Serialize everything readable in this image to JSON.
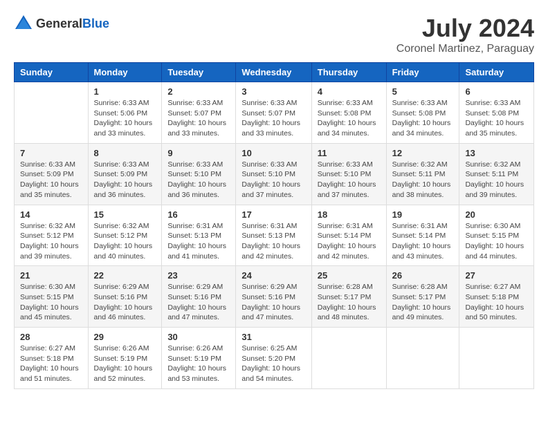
{
  "header": {
    "logo_general": "General",
    "logo_blue": "Blue",
    "month_year": "July 2024",
    "location": "Coronel Martinez, Paraguay"
  },
  "days_of_week": [
    "Sunday",
    "Monday",
    "Tuesday",
    "Wednesday",
    "Thursday",
    "Friday",
    "Saturday"
  ],
  "weeks": [
    [
      {
        "day": "",
        "sunrise": "",
        "sunset": "",
        "daylight": ""
      },
      {
        "day": "1",
        "sunrise": "Sunrise: 6:33 AM",
        "sunset": "Sunset: 5:06 PM",
        "daylight": "Daylight: 10 hours and 33 minutes."
      },
      {
        "day": "2",
        "sunrise": "Sunrise: 6:33 AM",
        "sunset": "Sunset: 5:07 PM",
        "daylight": "Daylight: 10 hours and 33 minutes."
      },
      {
        "day": "3",
        "sunrise": "Sunrise: 6:33 AM",
        "sunset": "Sunset: 5:07 PM",
        "daylight": "Daylight: 10 hours and 33 minutes."
      },
      {
        "day": "4",
        "sunrise": "Sunrise: 6:33 AM",
        "sunset": "Sunset: 5:08 PM",
        "daylight": "Daylight: 10 hours and 34 minutes."
      },
      {
        "day": "5",
        "sunrise": "Sunrise: 6:33 AM",
        "sunset": "Sunset: 5:08 PM",
        "daylight": "Daylight: 10 hours and 34 minutes."
      },
      {
        "day": "6",
        "sunrise": "Sunrise: 6:33 AM",
        "sunset": "Sunset: 5:08 PM",
        "daylight": "Daylight: 10 hours and 35 minutes."
      }
    ],
    [
      {
        "day": "7",
        "sunrise": "Sunrise: 6:33 AM",
        "sunset": "Sunset: 5:09 PM",
        "daylight": "Daylight: 10 hours and 35 minutes."
      },
      {
        "day": "8",
        "sunrise": "Sunrise: 6:33 AM",
        "sunset": "Sunset: 5:09 PM",
        "daylight": "Daylight: 10 hours and 36 minutes."
      },
      {
        "day": "9",
        "sunrise": "Sunrise: 6:33 AM",
        "sunset": "Sunset: 5:10 PM",
        "daylight": "Daylight: 10 hours and 36 minutes."
      },
      {
        "day": "10",
        "sunrise": "Sunrise: 6:33 AM",
        "sunset": "Sunset: 5:10 PM",
        "daylight": "Daylight: 10 hours and 37 minutes."
      },
      {
        "day": "11",
        "sunrise": "Sunrise: 6:33 AM",
        "sunset": "Sunset: 5:10 PM",
        "daylight": "Daylight: 10 hours and 37 minutes."
      },
      {
        "day": "12",
        "sunrise": "Sunrise: 6:32 AM",
        "sunset": "Sunset: 5:11 PM",
        "daylight": "Daylight: 10 hours and 38 minutes."
      },
      {
        "day": "13",
        "sunrise": "Sunrise: 6:32 AM",
        "sunset": "Sunset: 5:11 PM",
        "daylight": "Daylight: 10 hours and 39 minutes."
      }
    ],
    [
      {
        "day": "14",
        "sunrise": "Sunrise: 6:32 AM",
        "sunset": "Sunset: 5:12 PM",
        "daylight": "Daylight: 10 hours and 39 minutes."
      },
      {
        "day": "15",
        "sunrise": "Sunrise: 6:32 AM",
        "sunset": "Sunset: 5:12 PM",
        "daylight": "Daylight: 10 hours and 40 minutes."
      },
      {
        "day": "16",
        "sunrise": "Sunrise: 6:31 AM",
        "sunset": "Sunset: 5:13 PM",
        "daylight": "Daylight: 10 hours and 41 minutes."
      },
      {
        "day": "17",
        "sunrise": "Sunrise: 6:31 AM",
        "sunset": "Sunset: 5:13 PM",
        "daylight": "Daylight: 10 hours and 42 minutes."
      },
      {
        "day": "18",
        "sunrise": "Sunrise: 6:31 AM",
        "sunset": "Sunset: 5:14 PM",
        "daylight": "Daylight: 10 hours and 42 minutes."
      },
      {
        "day": "19",
        "sunrise": "Sunrise: 6:31 AM",
        "sunset": "Sunset: 5:14 PM",
        "daylight": "Daylight: 10 hours and 43 minutes."
      },
      {
        "day": "20",
        "sunrise": "Sunrise: 6:30 AM",
        "sunset": "Sunset: 5:15 PM",
        "daylight": "Daylight: 10 hours and 44 minutes."
      }
    ],
    [
      {
        "day": "21",
        "sunrise": "Sunrise: 6:30 AM",
        "sunset": "Sunset: 5:15 PM",
        "daylight": "Daylight: 10 hours and 45 minutes."
      },
      {
        "day": "22",
        "sunrise": "Sunrise: 6:29 AM",
        "sunset": "Sunset: 5:16 PM",
        "daylight": "Daylight: 10 hours and 46 minutes."
      },
      {
        "day": "23",
        "sunrise": "Sunrise: 6:29 AM",
        "sunset": "Sunset: 5:16 PM",
        "daylight": "Daylight: 10 hours and 47 minutes."
      },
      {
        "day": "24",
        "sunrise": "Sunrise: 6:29 AM",
        "sunset": "Sunset: 5:16 PM",
        "daylight": "Daylight: 10 hours and 47 minutes."
      },
      {
        "day": "25",
        "sunrise": "Sunrise: 6:28 AM",
        "sunset": "Sunset: 5:17 PM",
        "daylight": "Daylight: 10 hours and 48 minutes."
      },
      {
        "day": "26",
        "sunrise": "Sunrise: 6:28 AM",
        "sunset": "Sunset: 5:17 PM",
        "daylight": "Daylight: 10 hours and 49 minutes."
      },
      {
        "day": "27",
        "sunrise": "Sunrise: 6:27 AM",
        "sunset": "Sunset: 5:18 PM",
        "daylight": "Daylight: 10 hours and 50 minutes."
      }
    ],
    [
      {
        "day": "28",
        "sunrise": "Sunrise: 6:27 AM",
        "sunset": "Sunset: 5:18 PM",
        "daylight": "Daylight: 10 hours and 51 minutes."
      },
      {
        "day": "29",
        "sunrise": "Sunrise: 6:26 AM",
        "sunset": "Sunset: 5:19 PM",
        "daylight": "Daylight: 10 hours and 52 minutes."
      },
      {
        "day": "30",
        "sunrise": "Sunrise: 6:26 AM",
        "sunset": "Sunset: 5:19 PM",
        "daylight": "Daylight: 10 hours and 53 minutes."
      },
      {
        "day": "31",
        "sunrise": "Sunrise: 6:25 AM",
        "sunset": "Sunset: 5:20 PM",
        "daylight": "Daylight: 10 hours and 54 minutes."
      },
      {
        "day": "",
        "sunrise": "",
        "sunset": "",
        "daylight": ""
      },
      {
        "day": "",
        "sunrise": "",
        "sunset": "",
        "daylight": ""
      },
      {
        "day": "",
        "sunrise": "",
        "sunset": "",
        "daylight": ""
      }
    ]
  ]
}
